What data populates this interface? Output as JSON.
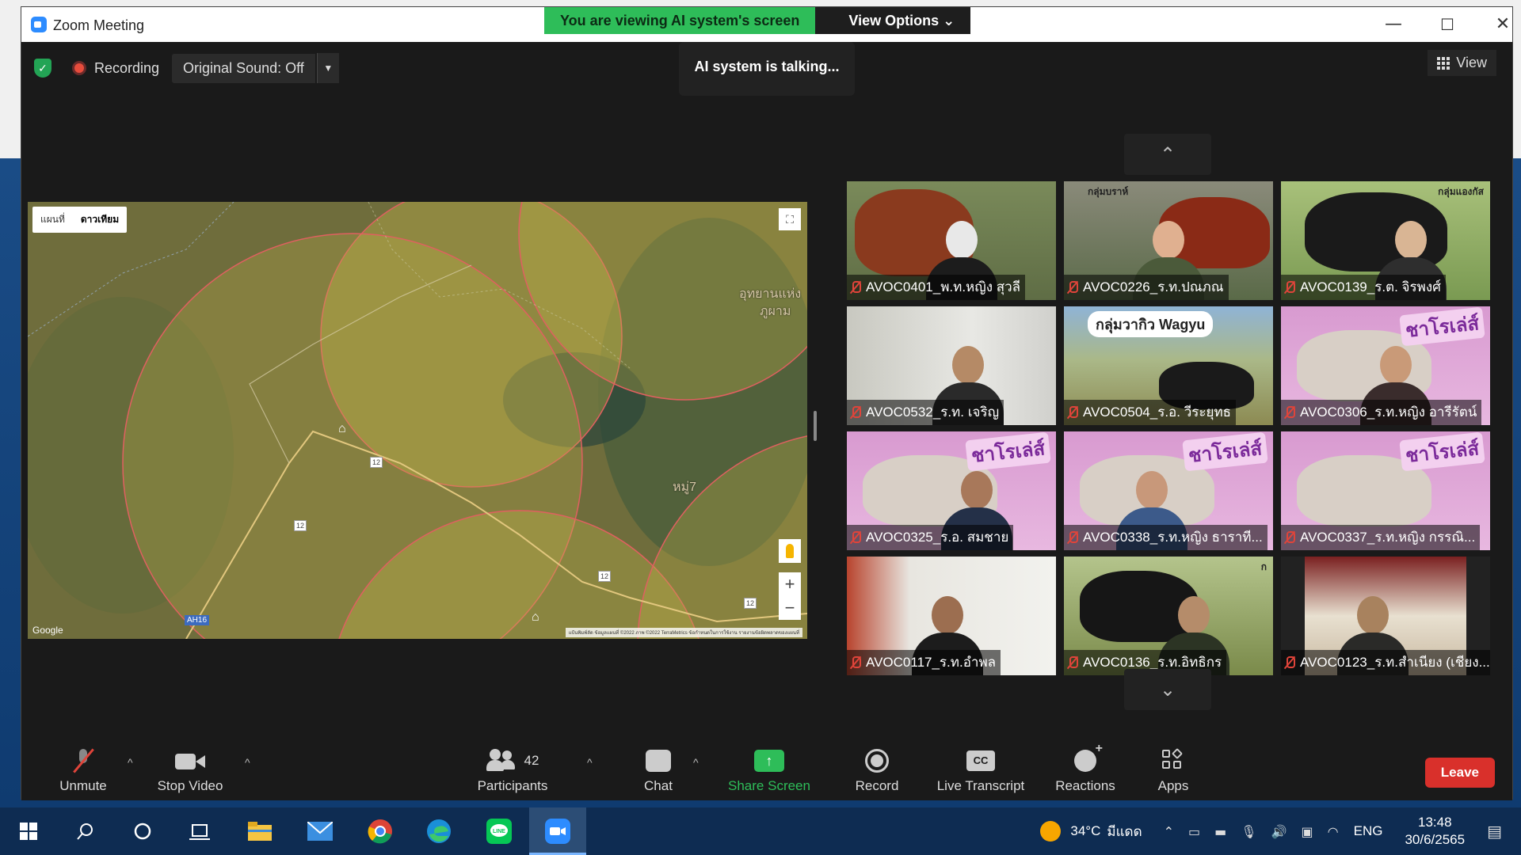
{
  "window": {
    "title": "Zoom Meeting",
    "minimize": "—",
    "maximize": "☐",
    "close": "✕"
  },
  "share_banner": {
    "viewing": "You are viewing AI system's screen",
    "view_options": "View Options",
    "view_options_caret": "⌄"
  },
  "top_bar": {
    "recording": "Recording",
    "original_sound": "Original Sound: Off",
    "talking": "AI system is talking...",
    "view": "View"
  },
  "map": {
    "tab_map": "แผนที่",
    "tab_satellite": "ดาวเทียม",
    "google": "Google",
    "terms": "แป้นพิมพ์ลัด  ข้อมูลแผนที่ ©2022 ภาพ ©2022 TerraMetrics  ข้อกำหนดในการใช้งาน  รายงานข้อผิดพลาดของแผนที่",
    "zoom_in": "+",
    "zoom_out": "−",
    "fullscreen": "⛶",
    "road_12": "12",
    "hwy": "AH16",
    "place_1": "อุทยานแห่ง",
    "place_2": "ภูผาม",
    "place_3": "หมู่7"
  },
  "gallery": {
    "page_up": "⌃",
    "page_down": "⌄",
    "tiles": [
      {
        "name": "AVOC0401_พ.ท.หญิง สุวลี",
        "overlay": ""
      },
      {
        "name": "AVOC0226_ร.ท.ปณภณ",
        "overlay": "กลุ่มบราห์"
      },
      {
        "name": "AVOC0139_ร.ต. จิรพงศ์",
        "overlay": "กลุ่มแองกัส"
      },
      {
        "name": "AVOC0532_ร.ท. เจริญ",
        "overlay": ""
      },
      {
        "name": "AVOC0504_ร.อ. วีระยุทธ",
        "overlay": "กลุ่มวากิว Wagyu"
      },
      {
        "name": "AVOC0306_ร.ท.หญิง อารีรัตน์",
        "overlay": "ชาโรเล่ส์"
      },
      {
        "name": "AVOC0325_ร.อ. สมชาย",
        "overlay": "ชาโรเล่ส์"
      },
      {
        "name": "AVOC0338_ร.ท.หญิง ธาราที...",
        "overlay": "ชาโรเล่ส์"
      },
      {
        "name": "AVOC0337_ร.ท.หญิง กรรณิ...",
        "overlay": "ชาโรเล่ส์"
      },
      {
        "name": "AVOC0117_ร.ท.อำพล",
        "overlay": ""
      },
      {
        "name": "AVOC0136_ร.ท.อิทธิกร",
        "overlay": "ก"
      },
      {
        "name": "AVOC0123_ร.ท.สำเนียง (เชียง...",
        "overlay": ""
      }
    ]
  },
  "toolbar": {
    "unmute": "Unmute",
    "stop_video": "Stop Video",
    "participants": "Participants",
    "participants_count": "42",
    "chat": "Chat",
    "share_screen": "Share Screen",
    "record": "Record",
    "live_transcript": "Live Transcript",
    "cc": "CC",
    "reactions": "Reactions",
    "apps": "Apps",
    "leave": "Leave",
    "caret": "^"
  },
  "taskbar": {
    "temperature": "34°C",
    "weather": "มีแดด",
    "language": "ENG",
    "time": "13:48",
    "date": "30/6/2565"
  },
  "colors": {
    "accent_green": "#2ebd59",
    "leave_red": "#d9302b",
    "muted_red": "#e0443a"
  }
}
